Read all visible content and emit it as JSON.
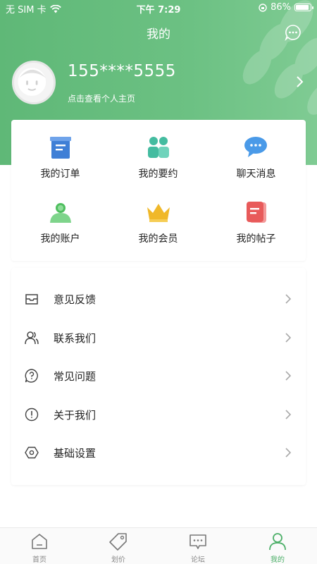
{
  "status_bar": {
    "carrier": "无 SIM 卡",
    "time": "下午 7:29",
    "battery": "86%"
  },
  "header": {
    "title": "我的",
    "message_icon": "chat-dots-icon"
  },
  "profile": {
    "phone": "155****5555",
    "subtitle": "点击查看个人主页"
  },
  "quick_grid": [
    {
      "label": "我的订单",
      "icon": "order-icon",
      "color": "#3f7fd6"
    },
    {
      "label": "我的要约",
      "icon": "people-icon",
      "color": "#44bca0"
    },
    {
      "label": "聊天消息",
      "icon": "chat-bubble-icon",
      "color": "#4a9ae8"
    },
    {
      "label": "我的账户",
      "icon": "account-icon",
      "color": "#4fbf5f"
    },
    {
      "label": "我的会员",
      "icon": "crown-icon",
      "color": "#f0b82a"
    },
    {
      "label": "我的帖子",
      "icon": "post-icon",
      "color": "#e85a5a"
    }
  ],
  "menu": [
    {
      "label": "意见反馈",
      "icon": "inbox-icon"
    },
    {
      "label": "联系我们",
      "icon": "contacts-icon"
    },
    {
      "label": "常见问题",
      "icon": "question-icon"
    },
    {
      "label": "关于我们",
      "icon": "info-icon"
    },
    {
      "label": "基础设置",
      "icon": "settings-hex-icon"
    }
  ],
  "tabbar": [
    {
      "label": "首页",
      "icon": "home-icon",
      "active": false
    },
    {
      "label": "划价",
      "icon": "tag-icon",
      "active": false
    },
    {
      "label": "论坛",
      "icon": "forum-icon",
      "active": false
    },
    {
      "label": "我的",
      "icon": "user-icon",
      "active": true
    }
  ],
  "colors": {
    "brand_green": "#5fb877",
    "active_tab": "#4caf68"
  }
}
